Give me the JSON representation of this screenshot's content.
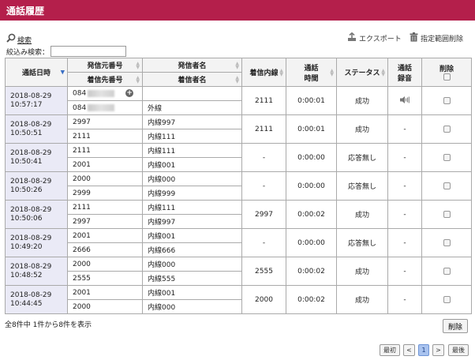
{
  "page": {
    "title": "通話履歴"
  },
  "toolbar": {
    "search_label": "検索",
    "export_label": "エクスポート",
    "range_delete_label": "指定範囲削除",
    "filter_label": "絞込み検索：",
    "filter_value": ""
  },
  "headers": {
    "datetime": "通話日時",
    "caller_number": "発信元番号",
    "caller_name": "発信者名",
    "callee_number": "着信先番号",
    "callee_name": "着信者名",
    "extension": "着信内線",
    "duration_1": "通話",
    "duration_2": "時間",
    "status": "ステータス",
    "recording_1": "通話",
    "recording_2": "録音",
    "delete": "削除"
  },
  "rows": [
    {
      "date": "2018-08-29",
      "time": "10:57:17",
      "from_number": "084",
      "from_name": "",
      "to_number": "084",
      "to_name": "外線",
      "extension": "2111",
      "duration": "0:00:01",
      "status": "成功",
      "recording": "speaker-icon"
    },
    {
      "date": "2018-08-29",
      "time": "10:50:51",
      "from_number": "2997",
      "from_name": "内線997",
      "to_number": "2111",
      "to_name": "内線111",
      "extension": "2111",
      "duration": "0:00:01",
      "status": "成功",
      "recording": "-"
    },
    {
      "date": "2018-08-29",
      "time": "10:50:41",
      "from_number": "2111",
      "from_name": "内線111",
      "to_number": "2001",
      "to_name": "内線001",
      "extension": "-",
      "duration": "0:00:00",
      "status": "応答無し",
      "recording": "-"
    },
    {
      "date": "2018-08-29",
      "time": "10:50:26",
      "from_number": "2000",
      "from_name": "内線000",
      "to_number": "2999",
      "to_name": "内線999",
      "extension": "-",
      "duration": "0:00:00",
      "status": "応答無し",
      "recording": "-"
    },
    {
      "date": "2018-08-29",
      "time": "10:50:06",
      "from_number": "2111",
      "from_name": "内線111",
      "to_number": "2997",
      "to_name": "内線997",
      "extension": "2997",
      "duration": "0:00:02",
      "status": "成功",
      "recording": "-"
    },
    {
      "date": "2018-08-29",
      "time": "10:49:20",
      "from_number": "2001",
      "from_name": "内線001",
      "to_number": "2666",
      "to_name": "内線666",
      "extension": "-",
      "duration": "0:00:00",
      "status": "応答無し",
      "recording": "-"
    },
    {
      "date": "2018-08-29",
      "time": "10:48:52",
      "from_number": "2000",
      "from_name": "内線000",
      "to_number": "2555",
      "to_name": "内線555",
      "extension": "2555",
      "duration": "0:00:02",
      "status": "成功",
      "recording": "-"
    },
    {
      "date": "2018-08-29",
      "time": "10:44:45",
      "from_number": "2001",
      "from_name": "内線001",
      "to_number": "2000",
      "to_name": "内線000",
      "extension": "2000",
      "duration": "0:00:02",
      "status": "成功",
      "recording": "-"
    }
  ],
  "footer": {
    "summary": "全8件中 1件から8件を表示",
    "delete_button": "削除"
  },
  "pagination": {
    "first": "最初",
    "prev": "<",
    "current": "1",
    "next": ">",
    "last": "最後"
  },
  "colors": {
    "title_bar": "#b41f4b",
    "date_cell_bg": "#eaeaf6",
    "active_page": "#a9c3ef"
  }
}
